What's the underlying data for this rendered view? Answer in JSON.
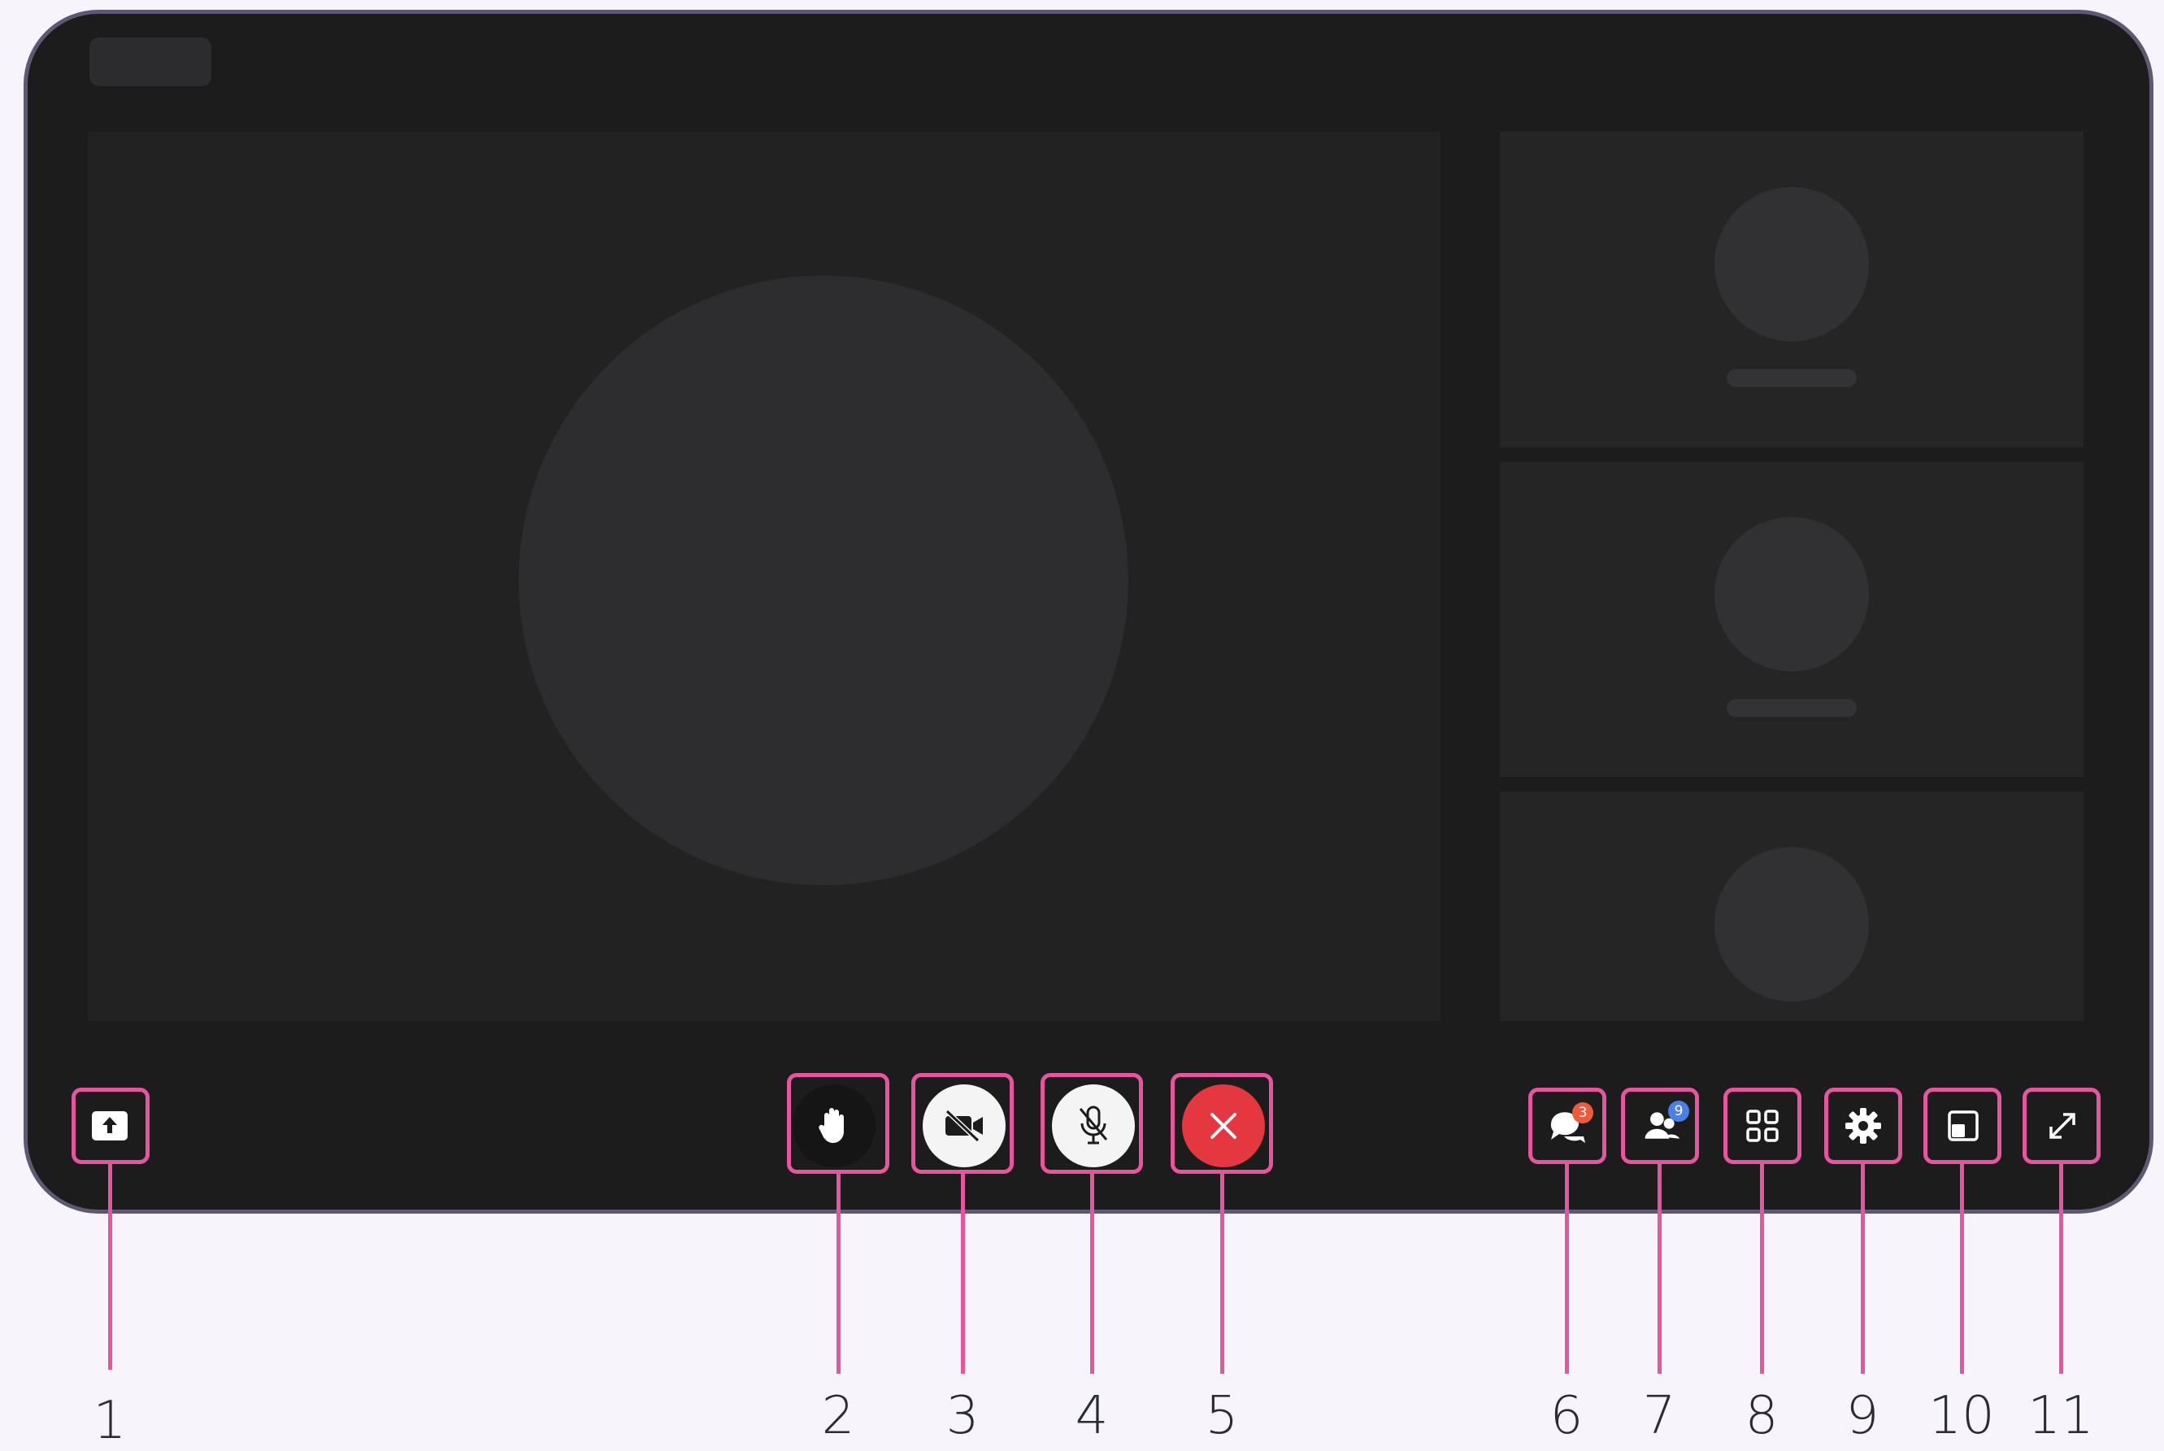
{
  "colors": {
    "background": "#f7f5fb",
    "device_frame": "#5e5874",
    "screen": "#1c1c1c",
    "tile": "#222223",
    "callout": "#e8559f",
    "end_call": "#e5373f",
    "chat_badge": "#f05a3c",
    "participants_badge": "#4a7ee8"
  },
  "controls": {
    "share_screen": {
      "icon": "upload-screen-icon"
    },
    "raise_hand": {
      "icon": "hand-icon"
    },
    "camera": {
      "icon": "video-off-icon"
    },
    "microphone": {
      "icon": "mic-off-icon"
    },
    "end_call": {
      "icon": "close-icon"
    },
    "chat": {
      "icon": "chat-bubbles-icon",
      "badge": "3"
    },
    "participants": {
      "icon": "people-icon",
      "badge": "9"
    },
    "layout": {
      "icon": "grid-icon"
    },
    "settings": {
      "icon": "gear-icon"
    },
    "picture_in_picture": {
      "icon": "pip-icon"
    },
    "fullscreen": {
      "icon": "expand-icon"
    }
  },
  "callouts": [
    "1",
    "2",
    "3",
    "4",
    "5",
    "6",
    "7",
    "8",
    "9",
    "10",
    "11"
  ]
}
